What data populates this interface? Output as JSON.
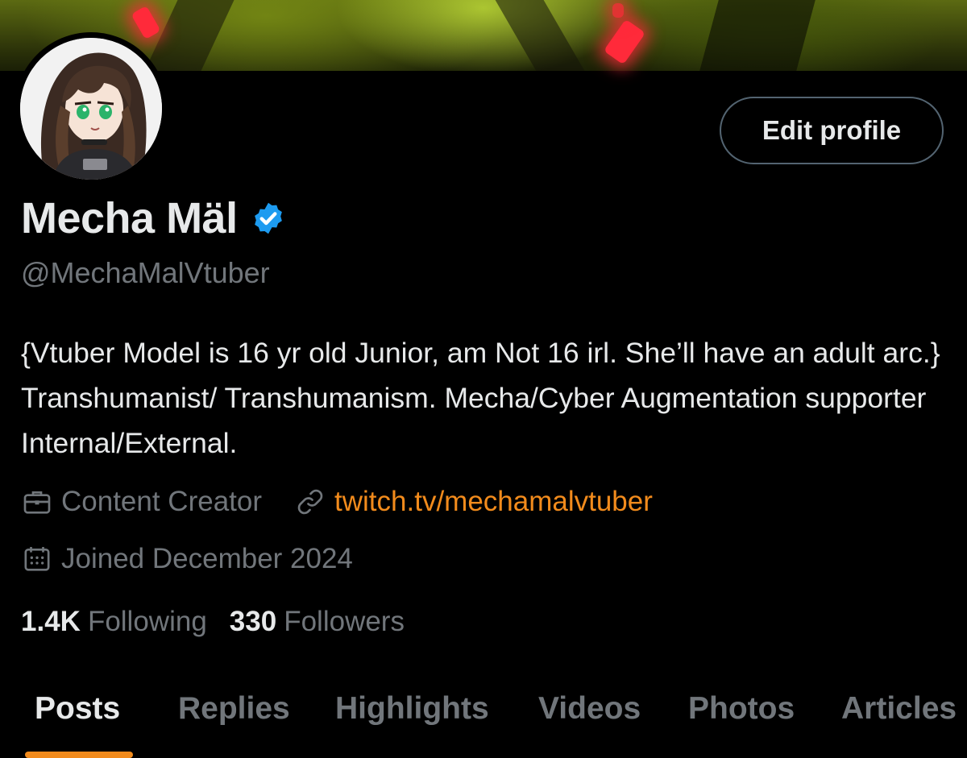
{
  "profile": {
    "display_name": "Mecha Mäl",
    "handle": "@MechaMalVtuber",
    "verified_icon": "verified-badge-icon",
    "bio": "{Vtuber Model is 16 yr old Junior, am Not 16 irl. She’ll have an adult arc.} Transhumanist/ Transhumanism. Mecha/Cyber Augmentation supporter Internal/External.",
    "category": "Content Creator",
    "link": "twitch.tv/mechamalvtuber",
    "joined": "Joined December 2024"
  },
  "actions": {
    "edit_profile_label": "Edit profile"
  },
  "stats": {
    "following_count": "1.4K",
    "following_label": "Following",
    "followers_count": "330",
    "followers_label": "Followers"
  },
  "tabs": [
    {
      "label": "Posts",
      "active": true
    },
    {
      "label": "Replies",
      "active": false
    },
    {
      "label": "Highlights",
      "active": false
    },
    {
      "label": "Videos",
      "active": false
    },
    {
      "label": "Photos",
      "active": false
    },
    {
      "label": "Articles",
      "active": false
    }
  ],
  "colors": {
    "background": "#000000",
    "text_primary": "#e7e9ea",
    "text_secondary": "#71767b",
    "accent": "#f28b1c",
    "verified": "#1d9bf0",
    "button_border": "#536471"
  }
}
